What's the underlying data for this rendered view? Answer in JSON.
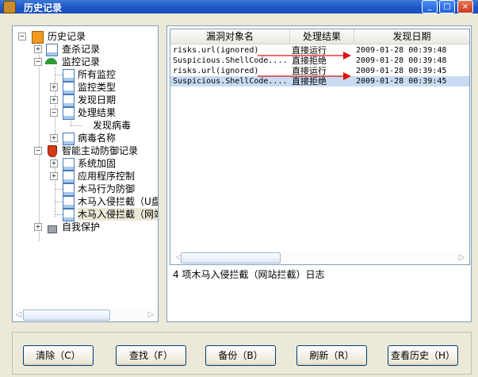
{
  "window": {
    "title": "历史记录",
    "controls": [
      "_",
      "□",
      "×"
    ]
  },
  "tree": {
    "root": "历史记录",
    "items": [
      {
        "label": "查杀记录"
      },
      {
        "label": "监控记录"
      },
      {
        "label": "所有监控"
      },
      {
        "label": "监控类型"
      },
      {
        "label": "发现日期"
      },
      {
        "label": "处理结果"
      },
      {
        "label": "发现病毒"
      },
      {
        "label": "病毒名称"
      },
      {
        "label": "智能主动防御记录"
      },
      {
        "label": "系统加固"
      },
      {
        "label": "应用程序控制"
      },
      {
        "label": "木马行为防御"
      },
      {
        "label": "木马入侵拦截（U盘"
      },
      {
        "label": "木马入侵拦截（网站"
      },
      {
        "label": "自我保护"
      }
    ]
  },
  "list": {
    "columns": [
      "漏洞对象名",
      "处理结果",
      "发现日期"
    ],
    "rows": [
      {
        "name": "risks.url(ignored)",
        "result": "直接运行",
        "date": "2009-01-28 00:39:48"
      },
      {
        "name": "Suspicious.ShellCode....",
        "result": "直接拒绝",
        "date": "2009-01-28 00:39:48"
      },
      {
        "name": "risks.url(ignored)",
        "result": "直接运行",
        "date": "2009-01-28 00:39:45"
      },
      {
        "name": "Suspicious.ShellCode....",
        "result": "直接拒绝",
        "date": "2009-01-28 00:39:45"
      }
    ],
    "status": "4 项木马入侵拦截（网站拦截）日志"
  },
  "buttons": {
    "clear": "清除（C）",
    "find": "查找（F）",
    "backup": "备份（B）",
    "refresh": "刷新（R）",
    "history": "查看历史（H）"
  },
  "colors": {
    "titlebar": "#1d55c4",
    "selection": "#c7dcf3",
    "arrow": "#e01010"
  }
}
